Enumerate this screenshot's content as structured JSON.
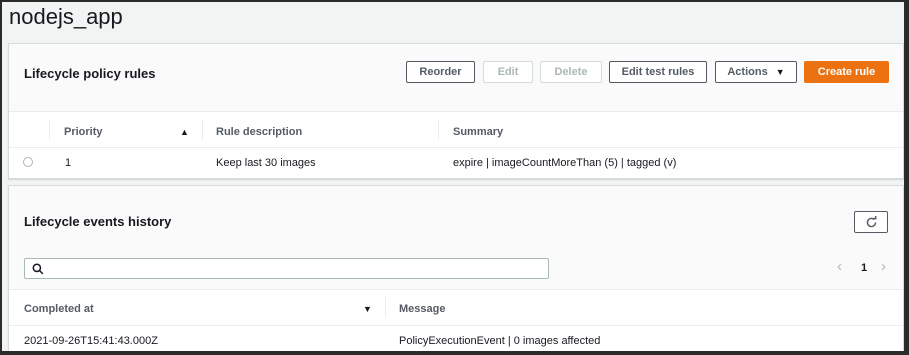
{
  "page": {
    "title": "nodejs_app"
  },
  "policy_panel": {
    "title": "Lifecycle policy rules",
    "buttons": {
      "reorder": "Reorder",
      "edit": "Edit",
      "delete": "Delete",
      "edit_test_rules": "Edit test rules",
      "actions": "Actions",
      "create_rule": "Create rule"
    },
    "columns": [
      "Priority",
      "Rule description",
      "Summary"
    ],
    "rows": [
      {
        "priority": "1",
        "description": "Keep last 30 images",
        "summary": "expire | imageCountMoreThan (5) | tagged (v)"
      }
    ]
  },
  "events_panel": {
    "title": "Lifecycle events history",
    "search": {
      "placeholder": "",
      "value": ""
    },
    "pagination": {
      "current_page": "1"
    },
    "columns": [
      "Completed at",
      "Message"
    ],
    "rows": [
      {
        "completed_at": "2021-09-26T15:41:43.000Z",
        "message": "PolicyExecutionEvent | 0 images affected"
      }
    ]
  },
  "icons": {
    "sort_ascending": "caret-up-icon",
    "sort_descending": "caret-down-icon",
    "refresh": "refresh-icon",
    "search": "search-icon",
    "prev": "chevron-left-icon",
    "next": "chevron-right-icon",
    "dropdown": "caret-down-icon"
  },
  "colors": {
    "primary": "#ec7211",
    "text": "#16191f",
    "muted": "#545b64",
    "disabled": "#aab7b8"
  }
}
